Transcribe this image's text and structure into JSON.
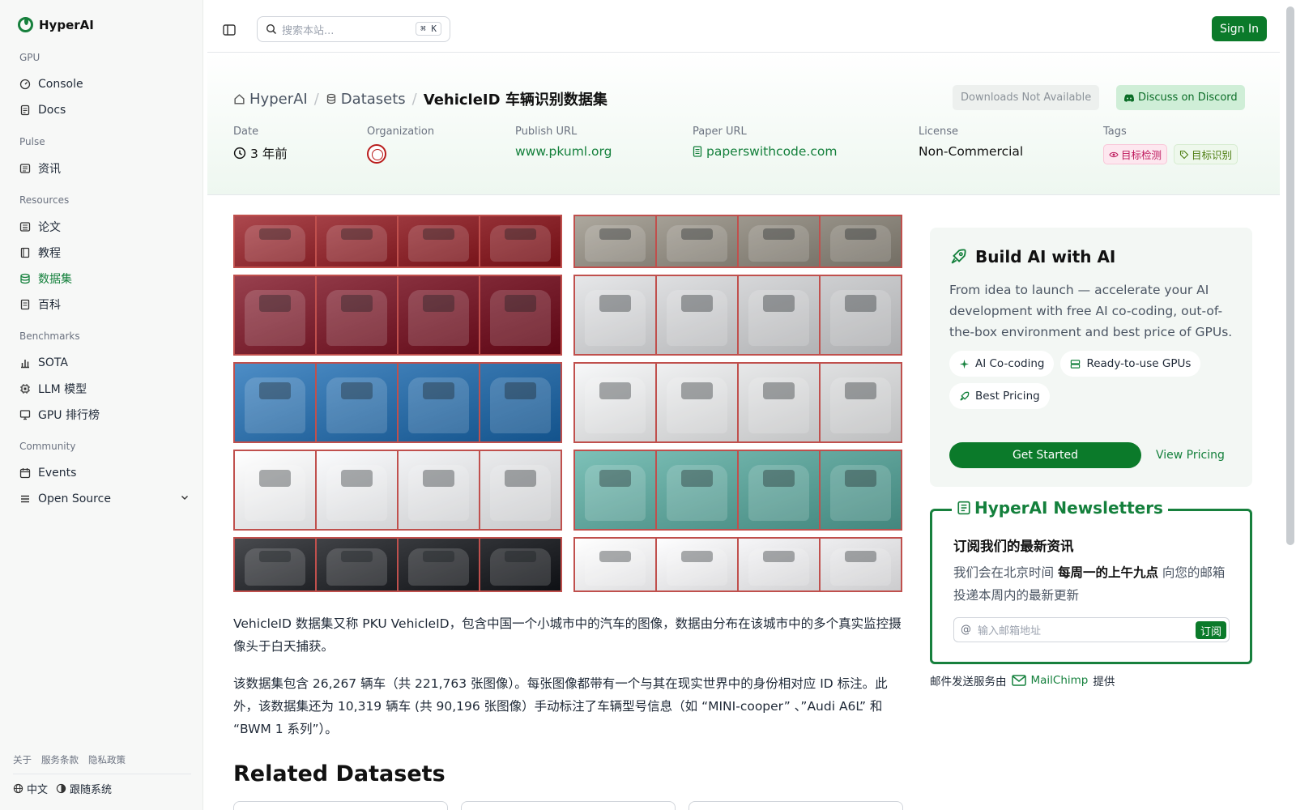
{
  "app": {
    "brand": "HyperAI"
  },
  "sidebar": {
    "sections": [
      {
        "label": "GPU",
        "items": [
          {
            "label": "Console",
            "icon": "gauge-icon"
          },
          {
            "label": "Docs",
            "icon": "doc-icon"
          }
        ]
      },
      {
        "label": "Pulse",
        "items": [
          {
            "label": "资讯",
            "icon": "news-icon"
          }
        ]
      },
      {
        "label": "Resources",
        "items": [
          {
            "label": "论文",
            "icon": "paper-icon"
          },
          {
            "label": "教程",
            "icon": "book-icon"
          },
          {
            "label": "数据集",
            "icon": "database-icon",
            "active": true
          },
          {
            "label": "百科",
            "icon": "wiki-icon"
          }
        ]
      },
      {
        "label": "Benchmarks",
        "items": [
          {
            "label": "SOTA",
            "icon": "bar-chart-icon"
          },
          {
            "label": "LLM 模型",
            "icon": "chip-icon"
          },
          {
            "label": "GPU 排行榜",
            "icon": "monitor-icon"
          }
        ]
      },
      {
        "label": "Community",
        "items": [
          {
            "label": "Events",
            "icon": "calendar-icon"
          },
          {
            "label": "Open Source",
            "icon": "list-icon"
          }
        ]
      }
    ],
    "footer_links": [
      "关于",
      "服务条款",
      "隐私政策"
    ],
    "language": "中文",
    "theme": "跟随系统"
  },
  "header": {
    "search_placeholder": "搜索本站...",
    "shortcut": "K",
    "signin_label": "Sign In"
  },
  "dataset": {
    "breadcrumb": {
      "home": "HyperAI",
      "section": "Datasets",
      "current": "VehicleID 车辆识别数据集"
    },
    "downloads_label": "Downloads Not Available",
    "discord_label": "Discuss on Discord",
    "meta": {
      "date_label": "Date",
      "date_value": "3 年前",
      "org_label": "Organization",
      "publish_label": "Publish URL",
      "publish_value": "www.pkuml.org",
      "paper_label": "Paper URL",
      "paper_value": "paperswithcode.com",
      "license_label": "License",
      "license_value": "Non-Commercial",
      "tags_label": "Tags",
      "tags": [
        "目标检测",
        "目标识别"
      ]
    },
    "description": [
      "VehicleID 数据集又称 PKU VehicleID，包含中国一个小城市中的汽车的图像，数据由分布在该城市中的多个真实监控摄像头于白天捕获。",
      "该数据集包含 26,267 辆车（共 221,763 张图像）。每张图像都带有一个与其在现实世界中的身份相对应 ID 标注。此外，该数据集还为 10,319 辆车 (共 90,196 张图像）手动标注了车辆型号信息（如 “MINI-cooper” 、”Audi A6L” 和 “BWM 1 系列”）。"
    ],
    "related_title": "Related Datasets"
  },
  "mosaic_colors": {
    "left": [
      "#8e2a30",
      "#7a2230",
      "#2f6fa8",
      "#e4e5e7",
      "#2a2c30"
    ],
    "right": [
      "#8f8a80",
      "#c8c9cb",
      "#d9dadb",
      "#5fa39a",
      "#e8e8ea"
    ]
  },
  "promo": {
    "title": "Build AI with AI",
    "description": "From idea to launch — accelerate your AI development with free AI co-coding, out-of-the-box environment and best price of GPUs.",
    "chips": [
      "AI Co-coding",
      "Ready-to-use GPUs",
      "Best Pricing"
    ],
    "cta": "Get Started",
    "pricing": "View Pricing"
  },
  "newsletter": {
    "title": "HyperAI Newsletters",
    "subtitle": "订阅我们的最新资讯",
    "desc_pre": "我们会在北京时间",
    "desc_bold": "每周一的上午九点",
    "desc_post": "向您的邮箱投递本周内的最新更新",
    "email_placeholder": "输入邮箱地址",
    "subscribe": "订阅",
    "provider_pre": "邮件发送服务由",
    "provider": "MailChimp",
    "provider_post": "提供"
  },
  "colors": {
    "accent": "#0b7a2a",
    "link": "#14803c"
  }
}
